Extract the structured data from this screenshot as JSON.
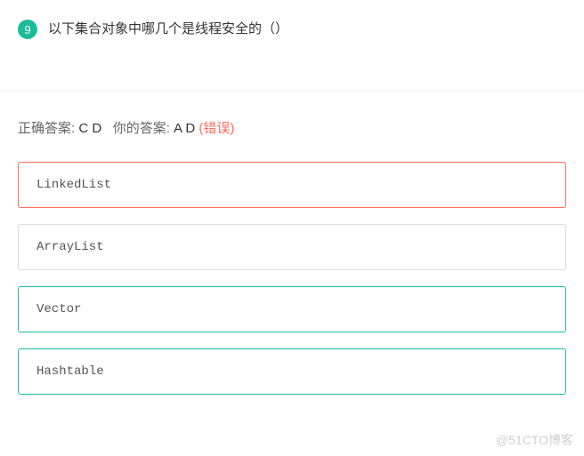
{
  "question": {
    "number": "9",
    "text": "以下集合对象中哪几个是线程安全的（）"
  },
  "answers": {
    "correct_label": "正确答案: ",
    "correct_value": "C D",
    "your_label": "你的答案: ",
    "your_value": "A D ",
    "wrong_flag": "(错误)"
  },
  "options": [
    {
      "text": "LinkedList",
      "state": "wrong"
    },
    {
      "text": "ArrayList",
      "state": "normal"
    },
    {
      "text": "Vector",
      "state": "correct"
    },
    {
      "text": "Hashtable",
      "state": "correct"
    }
  ],
  "watermark": "@51CTO博客"
}
